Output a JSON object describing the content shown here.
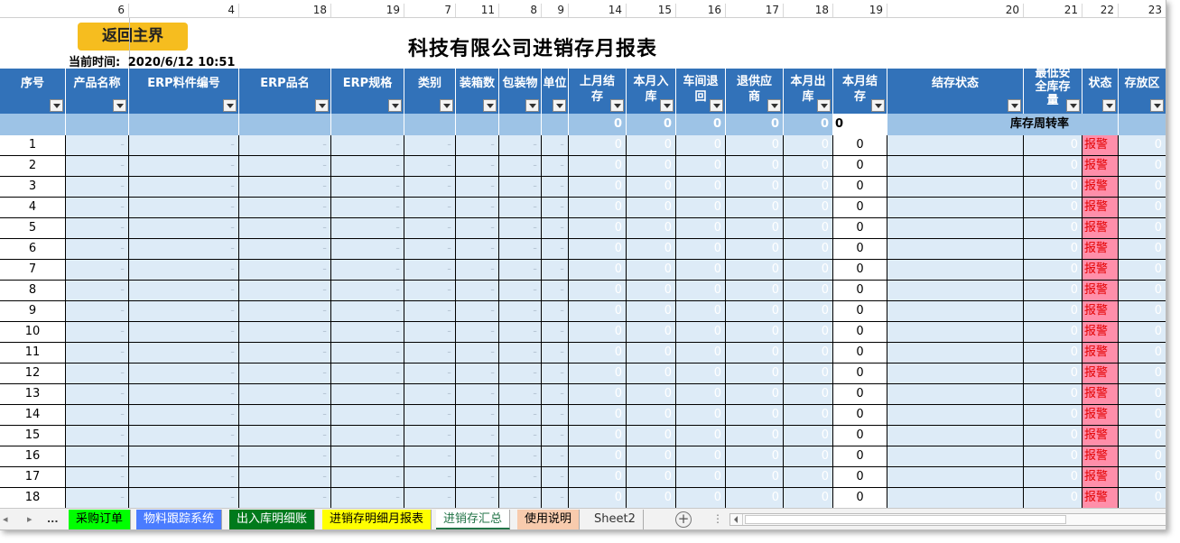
{
  "column_numbers": [
    "6",
    "4",
    "18",
    "19",
    "7",
    "11",
    "8",
    "9",
    "14",
    "15",
    "16",
    "17",
    "18",
    "19",
    "20",
    "21",
    "22",
    "23"
  ],
  "back_button": "返回主界",
  "current_time_label": "当前时间:",
  "current_time_value": "2020/6/12 10:51",
  "title": "科技有限公司进销存月报表",
  "headers": [
    "序号",
    "产品名称",
    "ERP料件编号",
    "ERP品名",
    "ERP规格",
    "类别",
    "装箱数",
    "包装物",
    "单位",
    "上月结存",
    "本月入库",
    "车间退回",
    "退供应商",
    "本月出库",
    "本月结存",
    "结存状态",
    "最低安全库存量",
    "状态",
    "存放区"
  ],
  "summary": {
    "last_month": "0",
    "this_month_in": "0",
    "workshop_return": "0",
    "return_supplier": "0",
    "this_month_out": "0",
    "this_month_balance": "0",
    "turnover_label": "库存周转率"
  },
  "rows": [
    {
      "idx": "1",
      "dash": "-",
      "zero": "0",
      "alarm": "报警"
    },
    {
      "idx": "2",
      "dash": "-",
      "zero": "0",
      "alarm": "报警"
    },
    {
      "idx": "3",
      "dash": "-",
      "zero": "0",
      "alarm": "报警"
    },
    {
      "idx": "4",
      "dash": "-",
      "zero": "0",
      "alarm": "报警"
    },
    {
      "idx": "5",
      "dash": "-",
      "zero": "0",
      "alarm": "报警"
    },
    {
      "idx": "6",
      "dash": "-",
      "zero": "0",
      "alarm": "报警"
    },
    {
      "idx": "7",
      "dash": "-",
      "zero": "0",
      "alarm": "报警"
    },
    {
      "idx": "8",
      "dash": "-",
      "zero": "0",
      "alarm": "报警"
    },
    {
      "idx": "9",
      "dash": "-",
      "zero": "0",
      "alarm": "报警"
    },
    {
      "idx": "10",
      "dash": "-",
      "zero": "0",
      "alarm": "报警"
    },
    {
      "idx": "11",
      "dash": "-",
      "zero": "0",
      "alarm": "报警"
    },
    {
      "idx": "12",
      "dash": "-",
      "zero": "0",
      "alarm": "报警"
    },
    {
      "idx": "13",
      "dash": "-",
      "zero": "0",
      "alarm": "报警"
    },
    {
      "idx": "14",
      "dash": "-",
      "zero": "0",
      "alarm": "报警"
    },
    {
      "idx": "15",
      "dash": "-",
      "zero": "0",
      "alarm": "报警"
    },
    {
      "idx": "16",
      "dash": "-",
      "zero": "0",
      "alarm": "报警"
    },
    {
      "idx": "17",
      "dash": "-",
      "zero": "0",
      "alarm": "报警"
    },
    {
      "idx": "18",
      "dash": "-",
      "zero": "0",
      "alarm": "报警"
    }
  ],
  "tabs": [
    {
      "label": "采购订单",
      "bg": "#00ff00",
      "color": "#000000"
    },
    {
      "label": "物料跟踪系统",
      "bg": "#4a7cff",
      "color": "#ffffff"
    },
    {
      "label": "出入库明细账",
      "bg": "#007a1c",
      "color": "#ffffff"
    },
    {
      "label": "进销存明细月报表",
      "bg": "#ffff00",
      "color": "#000000"
    },
    {
      "label": "进销存汇总",
      "bg": "#ffffff",
      "color": "#217346",
      "active": true
    },
    {
      "label": "使用说明",
      "bg": "#f8cbad",
      "color": "#000000"
    },
    {
      "label": "Sheet2",
      "bg": "#f2f2f2",
      "color": "#333333"
    }
  ],
  "tabs_more": "...",
  "add_sheet_icon": "plus-circle-icon"
}
